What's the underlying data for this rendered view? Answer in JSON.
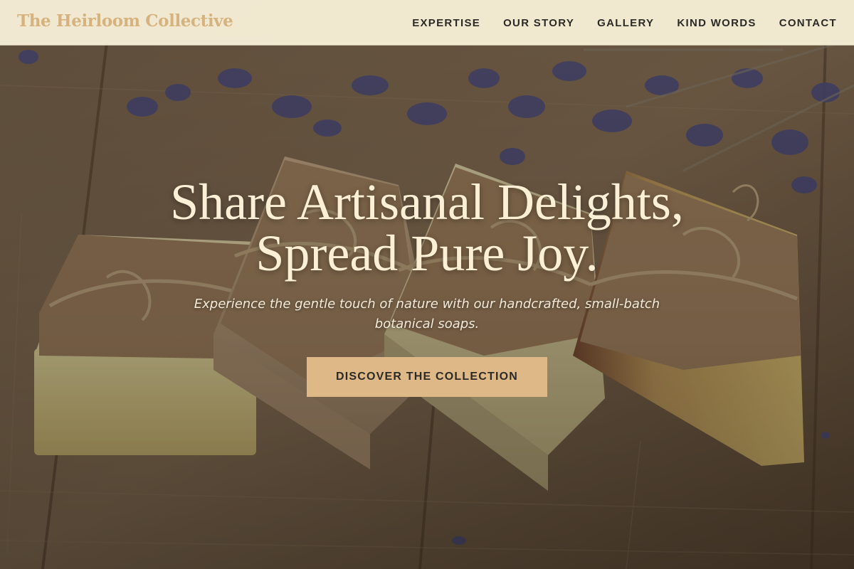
{
  "header": {
    "brand": "The Heirloom Collective",
    "nav": [
      {
        "label": "EXPERTISE"
      },
      {
        "label": "OUR STORY"
      },
      {
        "label": "GALLERY"
      },
      {
        "label": "KIND WORDS"
      },
      {
        "label": "CONTACT"
      }
    ]
  },
  "hero": {
    "title_line1": "Share Artisanal Delights,",
    "title_line2": "Spread Pure Joy.",
    "subtitle": "Experience the gentle touch of nature with our handcrafted, small-batch botanical soaps.",
    "cta_label": "DISCOVER THE COLLECTION",
    "background_image": "handmade soap bars tied with twine on wooden table with lavender"
  },
  "colors": {
    "header_bg": "#fbf4dc",
    "brand": "#d6b37e",
    "nav_text": "#2b2a26",
    "hero_text": "#fbf0d6",
    "cta_bg": "#deb887",
    "cta_text": "#2b2a26"
  }
}
